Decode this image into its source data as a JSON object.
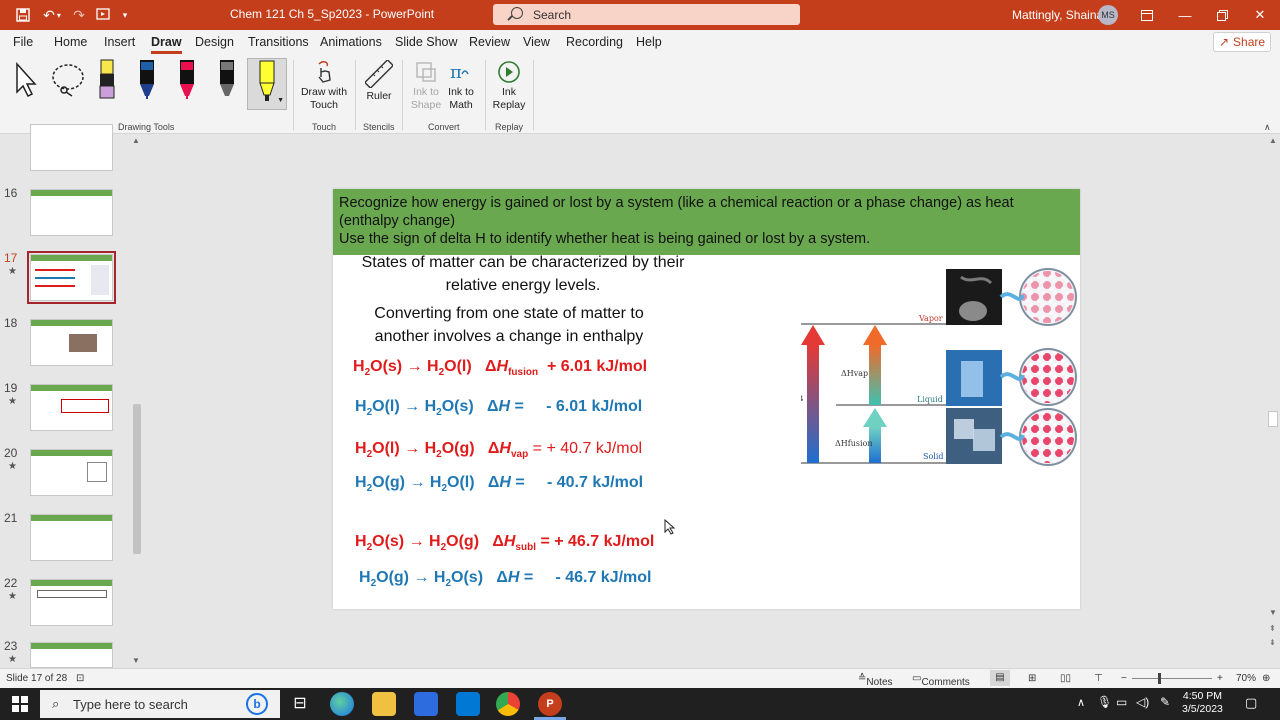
{
  "titlebar": {
    "doc_title": "Chem 121 Ch 5_Sp2023  -  PowerPoint",
    "search_label": "Search",
    "user_name": "Mattingly, Shaina",
    "avatar_initials": "MS"
  },
  "tabs": [
    "File",
    "Home",
    "Insert",
    "Draw",
    "Design",
    "Transitions",
    "Animations",
    "Slide Show",
    "Review",
    "View",
    "Recording",
    "Help"
  ],
  "active_tab": "Draw",
  "share_label": "Share",
  "ribbon": {
    "drawing_tools_label": "Drawing Tools",
    "touch": {
      "label": "Touch",
      "draw_with_touch": "Draw with Touch"
    },
    "stencils": {
      "label": "Stencils",
      "ruler": "Ruler"
    },
    "convert": {
      "label": "Convert",
      "ink_to_shape": "Ink to Shape",
      "ink_to_math": "Ink to Math"
    },
    "replay": {
      "label": "Replay",
      "ink_replay": "Ink Replay"
    }
  },
  "thumbnails": [
    {
      "num": "16",
      "star": ""
    },
    {
      "num": "17",
      "star": "★"
    },
    {
      "num": "18",
      "star": ""
    },
    {
      "num": "19",
      "star": "★"
    },
    {
      "num": "20",
      "star": "★"
    },
    {
      "num": "21",
      "star": ""
    },
    {
      "num": "22",
      "star": "★"
    },
    {
      "num": "23",
      "star": "★"
    }
  ],
  "slide": {
    "banner_line1": "Recognize how energy is gained or lost by a system (like a chemical reaction or a phase change) as heat (enthalpy change)",
    "banner_line2": "Use the sign of delta H to identify whether heat is being gained or lost by a system.",
    "text1": "States of matter can be characterized by their relative energy levels.",
    "text2": "Converting from one state of matter to another involves a change in enthalpy",
    "eq1_value": "+ 6.01 kJ/mol",
    "eq2_value": "- 6.01 kJ/mol",
    "eq3_value": "= + 40.7 kJ/mol",
    "eq4_value": "- 40.7 kJ/mol",
    "eq5_value": "= + 46.7 kJ/mol",
    "eq6_value": "- 46.7 kJ/mol",
    "diagram": {
      "vapor": "Vapor",
      "liquid": "Liquid",
      "solid": "Solid",
      "dh_vap": "ΔHvap",
      "dh_fusion": "ΔHfusion"
    }
  },
  "status": {
    "slide_info": "Slide 17 of 28",
    "notes": "Notes",
    "comments": "Comments",
    "zoom": "70%"
  },
  "taskbar": {
    "search_placeholder": "Type here to search",
    "time": "4:50 PM",
    "date": "3/5/2023"
  }
}
